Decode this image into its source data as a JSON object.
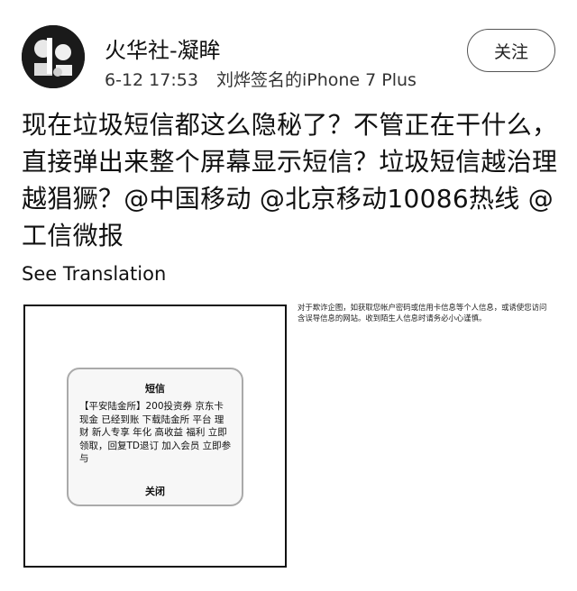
{
  "user": {
    "name": "火华社-凝眸",
    "time": "6-12 17:53",
    "device": "刘烨签名的iPhone 7 Plus"
  },
  "follow_label": "关注",
  "post": {
    "text": "现在垃圾短信都这么隐秘了？不管正在干什么，直接弹出来整个屏幕显示短信？垃圾短信越治理越猖獗？@中国移动 @北京移动10086热线 @工信微报",
    "translate_label": "See Translation"
  },
  "images": {
    "dialog_title": "短信",
    "dialog_body": "【平安陆金所】200投资券 京东卡 现金 已经到账 下载陆金所 平台 理财 新人专享 年化 高收益 福利 立即领取，回复TD退订 加入会员 立即参与",
    "dialog_close": "关闭",
    "side_text": "对于欺诈企图，如获取您帐户密码或信用卡信息等个人信息，或诱使您访问含误导信息的网站。收到陌生人信息时请务必小心谨慎。"
  }
}
